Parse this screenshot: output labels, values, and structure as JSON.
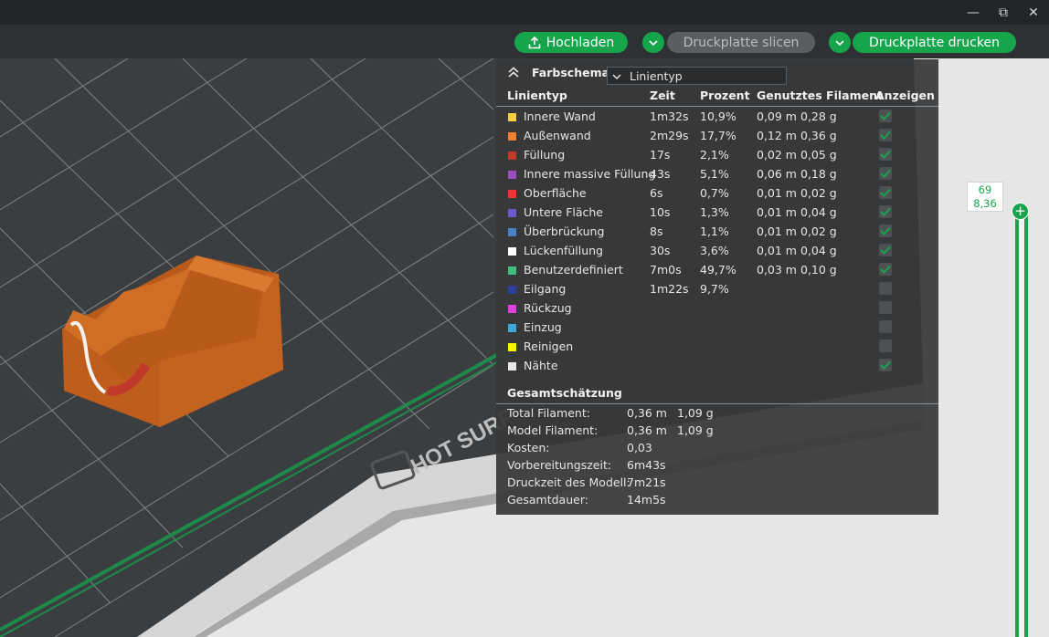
{
  "window": {
    "controls": [
      "—",
      "⧉",
      "✕"
    ]
  },
  "toolbar": {
    "upload_label": "Hochladen",
    "slice_label": "Druckplatte slicen",
    "print_label": "Druckplatte drucken"
  },
  "scene": {
    "bed_text": "HOT SURF"
  },
  "panel": {
    "title": "Farbschema",
    "dropdown_value": "Linientyp",
    "headers": {
      "type": "Linientyp",
      "time": "Zeit",
      "percent": "Prozent",
      "filament": "Genutztes Filament",
      "show": "Anzeigen"
    },
    "rows": [
      {
        "name": "Innere Wand",
        "time": "1m32s",
        "percent": "10,9%",
        "meters": "0,09 m",
        "grams": "0,28 g",
        "color": "#f4d03f",
        "checked": true
      },
      {
        "name": "Außenwand",
        "time": "2m29s",
        "percent": "17,7%",
        "meters": "0,12 m",
        "grams": "0,36 g",
        "color": "#f08030",
        "checked": true
      },
      {
        "name": "Füllung",
        "time": "17s",
        "percent": "2,1%",
        "meters": "0,02 m",
        "grams": "0,05 g",
        "color": "#c0392b",
        "checked": true
      },
      {
        "name": "Innere massive Füllung",
        "time": "43s",
        "percent": "5,1%",
        "meters": "0,06 m",
        "grams": "0,18 g",
        "color": "#9b4fbf",
        "checked": true
      },
      {
        "name": "Oberfläche",
        "time": "6s",
        "percent": "0,7%",
        "meters": "0,01 m",
        "grams": "0,02 g",
        "color": "#e53935",
        "checked": true
      },
      {
        "name": "Untere Fläche",
        "time": "10s",
        "percent": "1,3%",
        "meters": "0,01 m",
        "grams": "0,04 g",
        "color": "#6a5acd",
        "checked": true
      },
      {
        "name": "Überbrückung",
        "time": "8s",
        "percent": "1,1%",
        "meters": "0,01 m",
        "grams": "0,02 g",
        "color": "#4a80c8",
        "checked": true
      },
      {
        "name": "Lückenfüllung",
        "time": "30s",
        "percent": "3,6%",
        "meters": "0,01 m",
        "grams": "0,04 g",
        "color": "#ffffff",
        "checked": true
      },
      {
        "name": "Benutzerdefiniert",
        "time": "7m0s",
        "percent": "49,7%",
        "meters": "0,03 m",
        "grams": "0,10 g",
        "color": "#3fbf7f",
        "checked": true
      },
      {
        "name": "Eilgang",
        "time": "1m22s",
        "percent": "9,7%",
        "meters": "",
        "grams": "",
        "color": "#2e3f9e",
        "checked": false
      },
      {
        "name": "Rückzug",
        "time": "",
        "percent": "",
        "meters": "",
        "grams": "",
        "color": "#e040e0",
        "checked": false
      },
      {
        "name": "Einzug",
        "time": "",
        "percent": "",
        "meters": "",
        "grams": "",
        "color": "#3fa9d6",
        "checked": false
      },
      {
        "name": "Reinigen",
        "time": "",
        "percent": "",
        "meters": "",
        "grams": "",
        "color": "#f5f500",
        "checked": false
      },
      {
        "name": "Nähte",
        "time": "",
        "percent": "",
        "meters": "",
        "grams": "",
        "color": "#e8e8e8",
        "checked": true
      }
    ],
    "summary": {
      "title": "Gesamtschätzung",
      "rows": [
        {
          "label": "Total Filament:",
          "v1": "0,36 m",
          "v2": "1,09 g"
        },
        {
          "label": "Model Filament:",
          "v1": "0,36 m",
          "v2": "1,09 g"
        },
        {
          "label": "Kosten:",
          "v1": "0,03",
          "v2": ""
        },
        {
          "label": "Vorbereitungszeit:",
          "v1": "6m43s",
          "v2": ""
        },
        {
          "label": "Druckzeit des Modell:",
          "v1": "7m21s",
          "v2": ""
        },
        {
          "label": "Gesamtdauer:",
          "v1": "14m5s",
          "v2": ""
        }
      ]
    }
  },
  "slider": {
    "layer": "69",
    "height": "8,36"
  },
  "colors": {
    "accent": "#17a54c",
    "panel_bg": "#36383a",
    "bed": "#3b3e41",
    "model": "#c9661f"
  }
}
